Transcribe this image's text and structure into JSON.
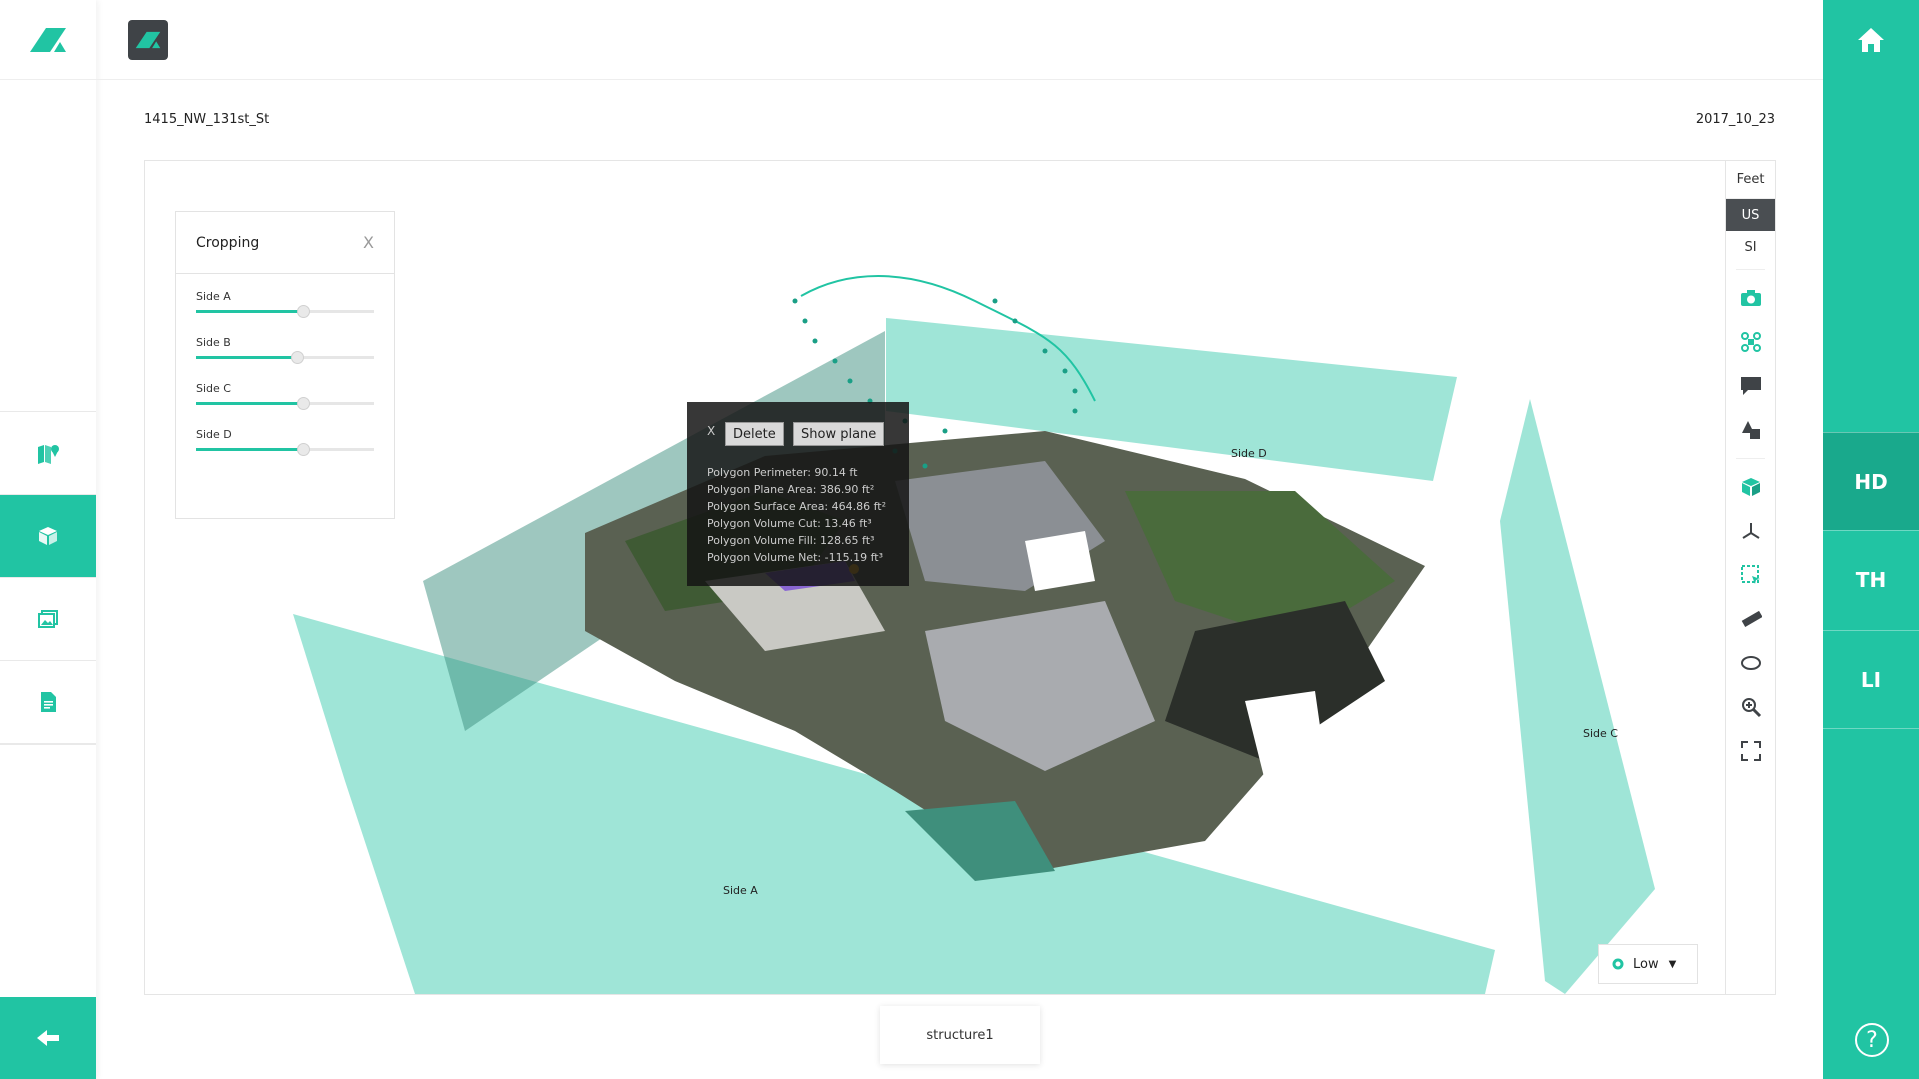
{
  "header": {
    "project_name": "1415_NW_131st_St",
    "date": "2017_10_23"
  },
  "toolbar": {
    "unit_label": "Feet",
    "units": [
      "US",
      "SI"
    ],
    "active_unit": "US"
  },
  "crop_panel": {
    "title": "Cropping",
    "close": "X",
    "sliders": [
      {
        "label": "Side A",
        "value": 0.6
      },
      {
        "label": "Side B",
        "value": 0.57
      },
      {
        "label": "Side C",
        "value": 0.6
      },
      {
        "label": "Side D",
        "value": 0.6
      }
    ]
  },
  "popup": {
    "close": "X",
    "delete_label": "Delete",
    "show_plane_label": "Show plane",
    "lines": [
      "Polygon Perimeter: 90.14 ft",
      "Polygon Plane Area: 386.90 ft²",
      "Polygon Surface Area: 464.86 ft²",
      "Polygon Volume Cut: 13.46 ft³",
      "Polygon Volume Fill: 128.65 ft³",
      "Polygon Volume Net: -115.19 ft³"
    ]
  },
  "side_labels": {
    "a": "Side A",
    "c": "Side C",
    "d": "Side D"
  },
  "quality": {
    "label": "Low"
  },
  "structure_tab": {
    "label": "structure1"
  },
  "right_rail": {
    "tabs": [
      "HD",
      "TH",
      "LI"
    ],
    "active_tab": "HD",
    "help": "?"
  },
  "colors": {
    "accent": "#21c4a3",
    "dark": "#3f4347"
  }
}
